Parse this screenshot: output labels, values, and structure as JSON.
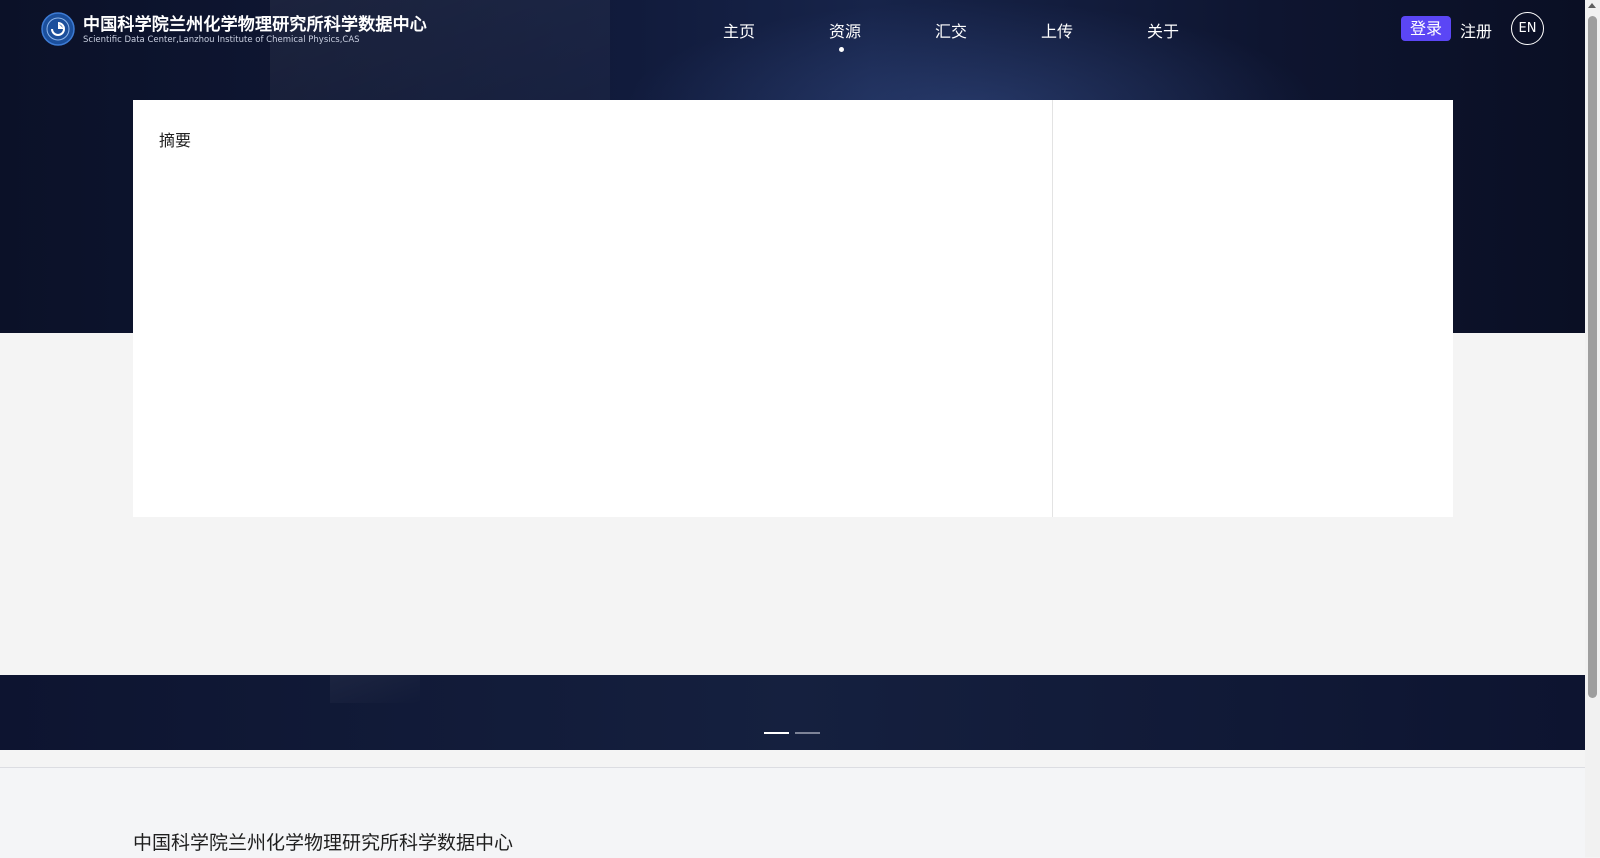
{
  "header": {
    "logo_icon": "institute-seal-icon",
    "org_name": "中国科学院兰州化学物理研究所科学数据中心",
    "org_subtitle": "Scientific Data Center,Lanzhou Institute of Chemical Physics,CAS",
    "nav": [
      {
        "label": "主页",
        "active": false
      },
      {
        "label": "资源",
        "active": true
      },
      {
        "label": "汇交",
        "active": false
      },
      {
        "label": "上传",
        "active": false
      },
      {
        "label": "关于",
        "active": false
      }
    ],
    "login_label": "登录",
    "register_label": "注册",
    "language_label": "EN"
  },
  "detail": {
    "abstract_heading": "摘要"
  },
  "carousel": {
    "slides": 2,
    "active_index": 0
  },
  "footer": {
    "title": "中国科学院兰州化学物理研究所科学数据中心"
  },
  "colors": {
    "accent": "#5b46f5",
    "header_bg": "#0b1128",
    "page_bg": "#f4f4f4"
  }
}
